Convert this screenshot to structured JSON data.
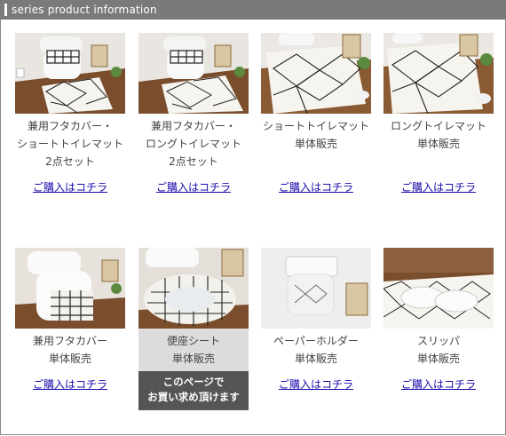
{
  "header": {
    "title": "series product information"
  },
  "products": [
    {
      "caption": [
        "兼用フタカバー・",
        "ショートトイレマット",
        "2点セット"
      ],
      "link": "ご購入はコチラ",
      "scene": "set"
    },
    {
      "caption": [
        "兼用フタカバー・",
        "ロングトイレマット",
        "2点セット"
      ],
      "link": "ご購入はコチラ",
      "scene": "set"
    },
    {
      "caption": [
        "ショートトイレマット",
        "単体販売"
      ],
      "link": "ご購入はコチラ",
      "scene": "mat"
    },
    {
      "caption": [
        "ロングトイレマット",
        "単体販売"
      ],
      "link": "ご購入はコチラ",
      "scene": "longmat"
    },
    {
      "caption": [
        "兼用フタカバー",
        "単体販売"
      ],
      "link": "ご購入はコチラ",
      "scene": "cover"
    },
    {
      "caption": [
        "便座シート",
        "単体販売"
      ],
      "badge": [
        "このページで",
        "お買い求め頂けます"
      ],
      "scene": "seat",
      "current": true
    },
    {
      "caption": [
        "ペーパーホルダー",
        "単体販売"
      ],
      "link": "ご購入はコチラ",
      "scene": "holder"
    },
    {
      "caption": [
        "スリッパ",
        "単体販売"
      ],
      "link": "ご購入はコチラ",
      "scene": "slipper"
    }
  ],
  "colors": {
    "header": "#7a7a7a",
    "link": "#1a0dab",
    "badge": "#555555",
    "current_bg": "#dcdcdc"
  }
}
